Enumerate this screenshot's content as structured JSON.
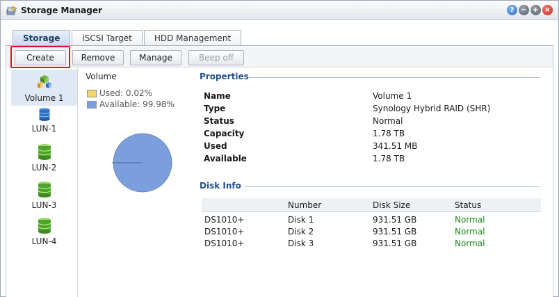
{
  "window": {
    "title": "Storage Manager"
  },
  "tabs": [
    {
      "label": "Storage",
      "active": true
    },
    {
      "label": "iSCSI Target",
      "active": false
    },
    {
      "label": "HDD Management",
      "active": false
    }
  ],
  "toolbar": {
    "create": "Create",
    "remove": "Remove",
    "manage": "Manage",
    "beep_off": "Beep off"
  },
  "sidebar": {
    "items": [
      {
        "label": "Volume 1",
        "icon": "volume-icon",
        "selected": true
      },
      {
        "label": "LUN-1",
        "icon": "lun-blue-icon",
        "selected": false
      },
      {
        "label": "LUN-2",
        "icon": "lun-green-icon",
        "selected": false
      },
      {
        "label": "LUN-3",
        "icon": "lun-green-icon",
        "selected": false
      },
      {
        "label": "LUN-4",
        "icon": "lun-green-icon",
        "selected": false
      }
    ]
  },
  "volume_chart": {
    "label": "Volume",
    "used_label": "Used: 0.02%",
    "available_label": "Available: 99.98%",
    "used_percent": 0.02,
    "available_percent": 99.98,
    "used_color": "#f5d46a",
    "available_color": "#7b9fdc"
  },
  "properties": {
    "title": "Properties",
    "rows": [
      {
        "key": "Name",
        "value": "Volume 1"
      },
      {
        "key": "Type",
        "value": "Synology Hybrid RAID (SHR)"
      },
      {
        "key": "Status",
        "value": "Normal"
      },
      {
        "key": "Capacity",
        "value": "1.78 TB"
      },
      {
        "key": "Used",
        "value": "341.51 MB"
      },
      {
        "key": "Available",
        "value": "1.78 TB"
      }
    ]
  },
  "disk_info": {
    "title": "Disk Info",
    "columns": [
      "",
      "Number",
      "Disk Size",
      "Status"
    ],
    "rows": [
      [
        "DS1010+",
        "Disk 1",
        "931.51 GB",
        "Normal"
      ],
      [
        "DS1010+",
        "Disk 2",
        "931.51 GB",
        "Normal"
      ],
      [
        "DS1010+",
        "Disk 3",
        "931.51 GB",
        "Normal"
      ]
    ],
    "status_color": "#1e8a1e"
  }
}
